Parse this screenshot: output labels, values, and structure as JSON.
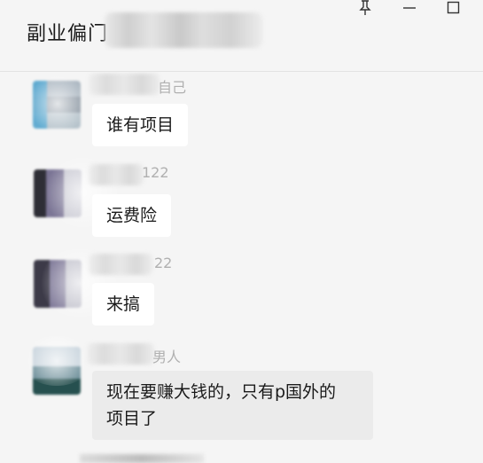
{
  "window": {
    "title": "副业偏门",
    "controls": {
      "pin": "pin-icon",
      "minimize": "minimize-icon",
      "maximize": "maximize-icon"
    }
  },
  "messages": [
    {
      "sender_visible": "自己",
      "text": "谁有项目"
    },
    {
      "sender_visible": "122",
      "text": "运费险"
    },
    {
      "sender_visible": "22",
      "text": "来搞"
    },
    {
      "sender_visible": "男人",
      "text": "现在要赚大钱的，只有p国外的\n项目了"
    }
  ],
  "colors": {
    "background": "#f5f5f5",
    "bubble": "#ffffff",
    "bubble_alt": "#ebebeb"
  }
}
